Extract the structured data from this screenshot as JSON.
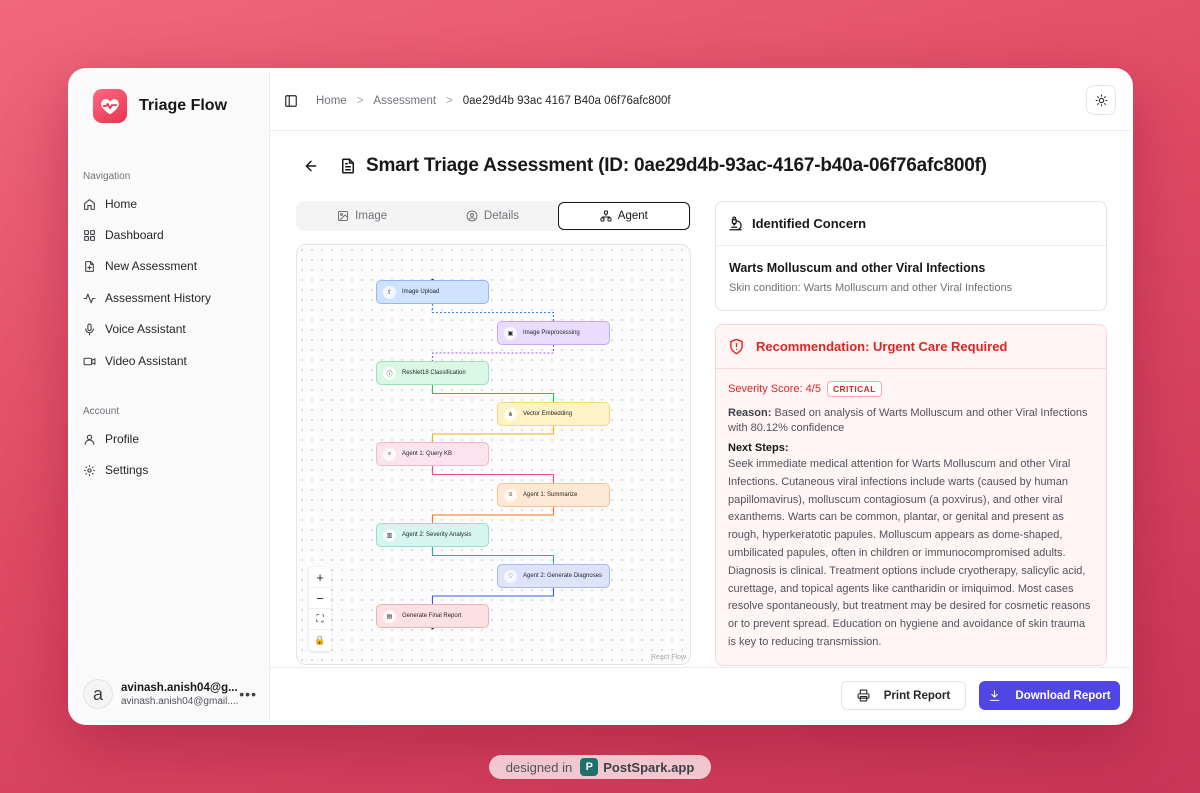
{
  "app": {
    "name": "Triage Flow"
  },
  "sidebar": {
    "nav_label": "Navigation",
    "nav_items": [
      {
        "label": "Home",
        "icon": "home-icon"
      },
      {
        "label": "Dashboard",
        "icon": "dashboard-icon"
      },
      {
        "label": "New Assessment",
        "icon": "file-plus-icon"
      },
      {
        "label": "Assessment History",
        "icon": "activity-icon"
      },
      {
        "label": "Voice Assistant",
        "icon": "mic-icon"
      },
      {
        "label": "Video Assistant",
        "icon": "video-icon"
      }
    ],
    "account_label": "Account",
    "account_items": [
      {
        "label": "Profile",
        "icon": "user-icon"
      },
      {
        "label": "Settings",
        "icon": "gear-icon"
      }
    ],
    "user": {
      "avatar_letter": "a",
      "name": "avinash.anish04@g...",
      "email": "avinash.anish04@gmail...."
    }
  },
  "breadcrumb": {
    "items": [
      "Home",
      "Assessment",
      "0ae29d4b 93ac 4167 B40a 06f76afc800f"
    ],
    "separator": ">"
  },
  "page": {
    "title": "Smart Triage Assessment (ID: 0ae29d4b-93ac-4167-b40a-06f76afc800f)"
  },
  "tabs": [
    {
      "label": "Image",
      "active": false
    },
    {
      "label": "Details",
      "active": false
    },
    {
      "label": "Agent",
      "active": true
    }
  ],
  "flow": {
    "attribution": "React Flow",
    "nodes": [
      {
        "label": "Image Upload",
        "color": "#cfe2ff",
        "border": "#93b8f5",
        "icon": "upload-icon"
      },
      {
        "label": "Image Preprocessing",
        "color": "#e9ddff",
        "border": "#c4a8f5",
        "icon": "image-icon"
      },
      {
        "label": "ResNet18 Classification",
        "color": "#d9f7e4",
        "border": "#9be2b6",
        "icon": "info-icon"
      },
      {
        "label": "Vector Embedding",
        "color": "#fdf3c4",
        "border": "#f1d97a",
        "icon": "network-icon"
      },
      {
        "label": "Agent 1: Query KB",
        "color": "#fce4ee",
        "border": "#f5b5cc",
        "icon": "search-icon"
      },
      {
        "label": "Agent 1: Summarize",
        "color": "#fde8d4",
        "border": "#f6c393",
        "icon": "doc-icon"
      },
      {
        "label": "Agent 2: Severity Analysis",
        "color": "#d5f5ee",
        "border": "#8fe0cd",
        "icon": "chart-icon"
      },
      {
        "label": "Agent 2: Generate Diagnoses",
        "color": "#dde3fb",
        "border": "#aab7f1",
        "icon": "stethoscope-icon"
      },
      {
        "label": "Generate Final Report",
        "color": "#fde0e2",
        "border": "#f5aeb4",
        "icon": "report-icon"
      }
    ],
    "edge_colors": [
      "#3b82f6",
      "#a855f7",
      "#22c55e",
      "#eab308",
      "#ec4899",
      "#f97316",
      "#14b8a6",
      "#3b5bdb"
    ],
    "controls": [
      "+",
      "−",
      "⛶",
      "🔒"
    ]
  },
  "concern": {
    "heading": "Identified Concern",
    "name": "Warts Molluscum and other Viral Infections",
    "subtitle": "Skin condition: Warts Molluscum and other Viral Infections"
  },
  "recommendation": {
    "heading": "Recommendation: Urgent Care Required",
    "severity": "Severity Score: 4/5",
    "badge": "CRITICAL",
    "reason_label": "Reason:",
    "reason": "Based on analysis of Warts Molluscum and other Viral Infections with 80.12% confidence",
    "next_label": "Next Steps:",
    "next_steps": "Seek immediate medical attention for Warts Molluscum and other Viral Infections. Cutaneous viral infections include warts (caused by human papillomavirus), molluscum contagiosum (a poxvirus), and other viral exanthems. Warts can be common, plantar, or genital and present as rough, hyperkeratotic papules. Molluscum appears as dome-shaped, umbilicated papules, often in children or immunocompromised adults. Diagnosis is clinical. Treatment options include cryotherapy, salicylic acid, curettage, and topical agents like cantharidin or imiquimod. Most cases resolve spontaneously, but treatment may be desired for cosmetic reasons or to prevent spread. Education on hygiene and avoidance of skin trauma is key to reducing transmission."
  },
  "footer": {
    "print_label": "Print Report",
    "download_label": "Download Report"
  },
  "watermark": {
    "prefix": "designed in",
    "logo_letter": "P",
    "brand": "PostSpark.app"
  },
  "colors": {
    "accent": "#4f46e5",
    "danger": "#dc2626",
    "brand": "#e8324f"
  }
}
